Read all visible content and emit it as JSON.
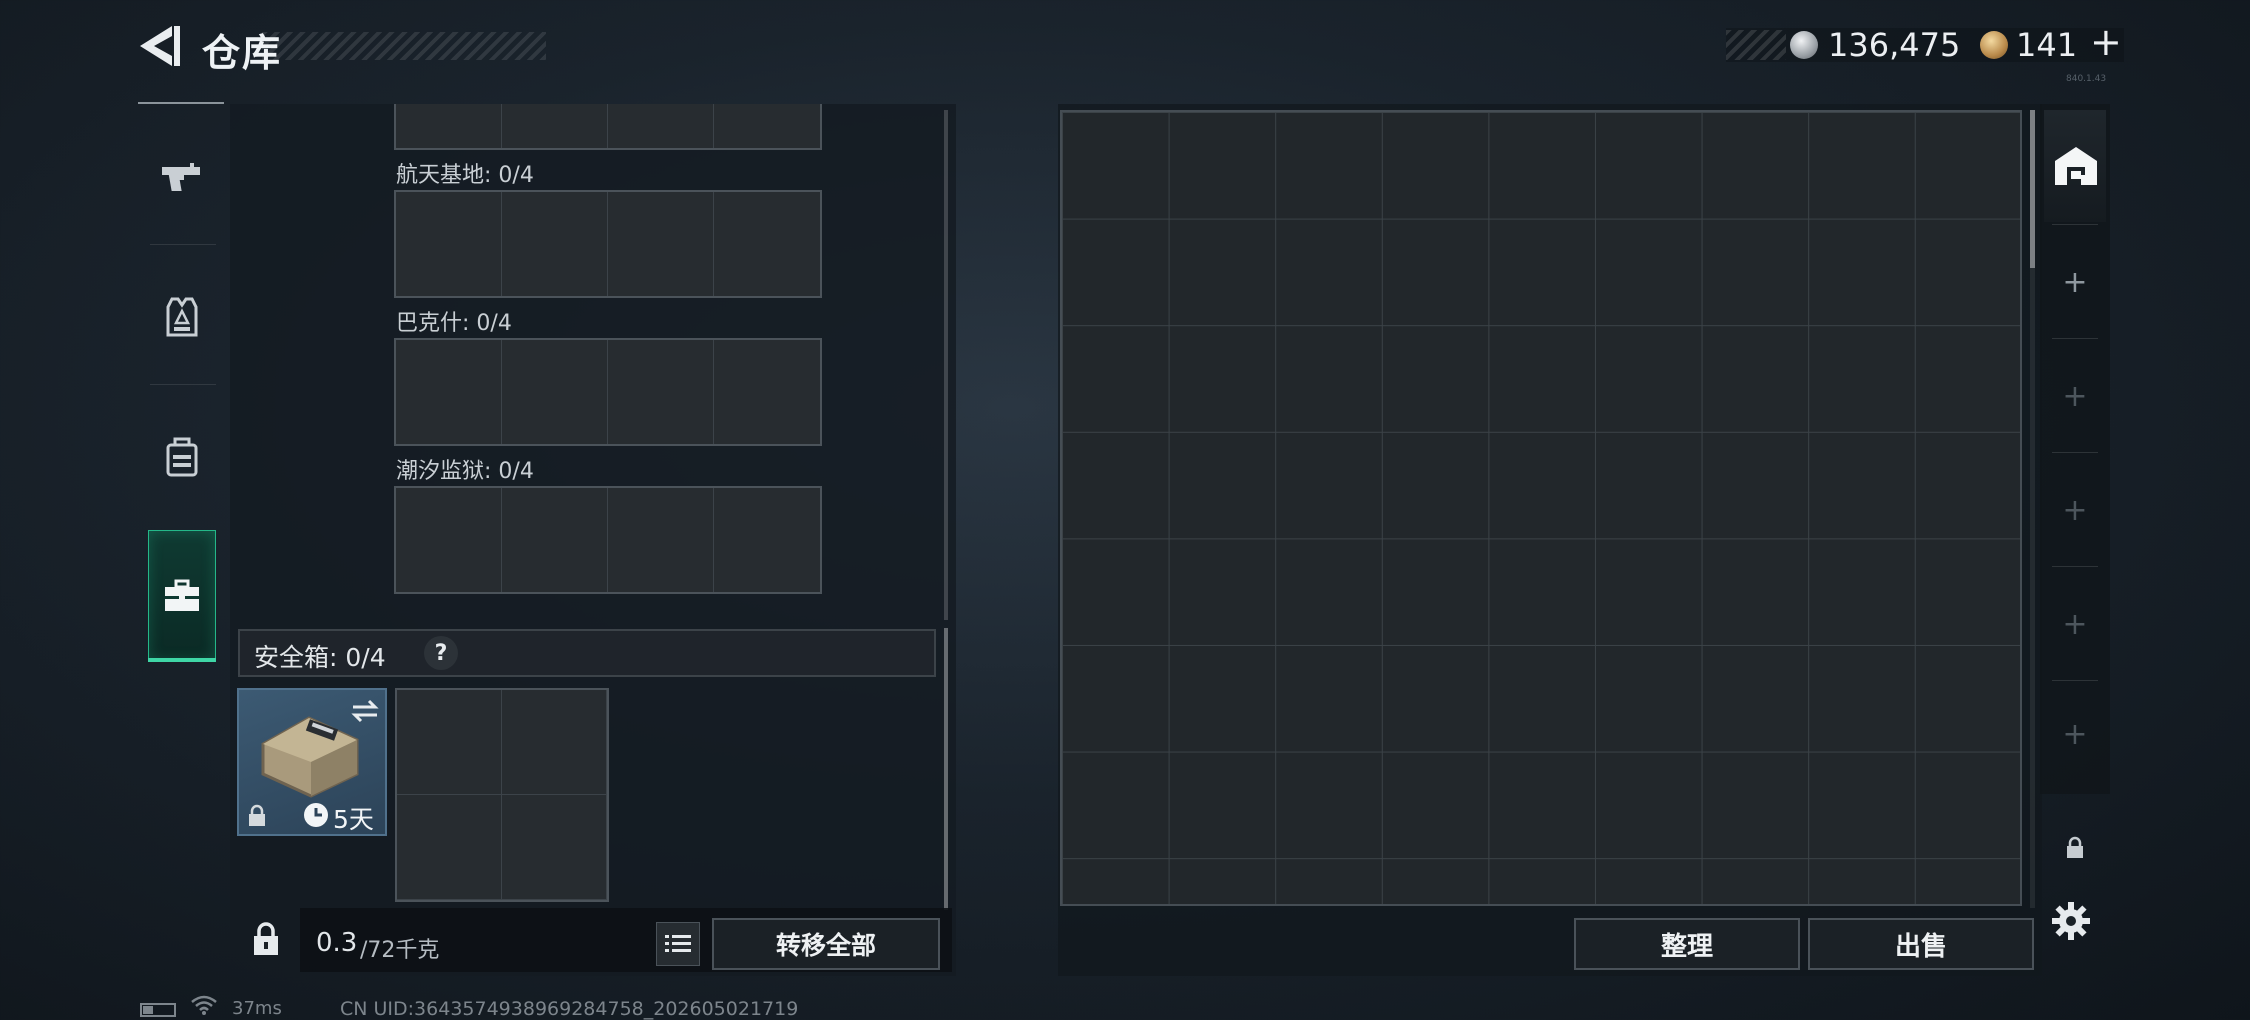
{
  "header": {
    "title": "仓库",
    "currency_silver": "136,475",
    "currency_gold": "141",
    "gold_plus": "+",
    "version_tiny": "840.1.43"
  },
  "side_tabs": [
    {
      "name": "weapons",
      "icon": "gun-icon",
      "active": false
    },
    {
      "name": "armor",
      "icon": "vest-icon",
      "active": false
    },
    {
      "name": "backpack",
      "icon": "backpack-icon",
      "active": false
    },
    {
      "name": "safebox",
      "icon": "briefcase-icon",
      "active": true
    }
  ],
  "storage": {
    "maps": [
      {
        "label": "航天基地: 0/4"
      },
      {
        "label": "巴克什: 0/4"
      },
      {
        "label": "潮汐监狱: 0/4"
      }
    ],
    "safebox_label": "安全箱:  0/4",
    "safebox_help": "?",
    "safebox_days": "5天",
    "weight_value": "0.3",
    "weight_max": "/72千克",
    "transfer_all": "转移全部"
  },
  "warehouse": {
    "sort_label": "整理",
    "sell_label": "出售"
  },
  "right_strip": {
    "slots": [
      "+",
      "+",
      "+",
      "+",
      "+"
    ]
  },
  "status": {
    "ping": "37ms",
    "uid": "CN UID:3643574938969284758_202605021719"
  },
  "colors": {
    "accent_green": "#3fd6a6",
    "panel_bg": "#141b22",
    "grid_line": "#3b4247"
  }
}
